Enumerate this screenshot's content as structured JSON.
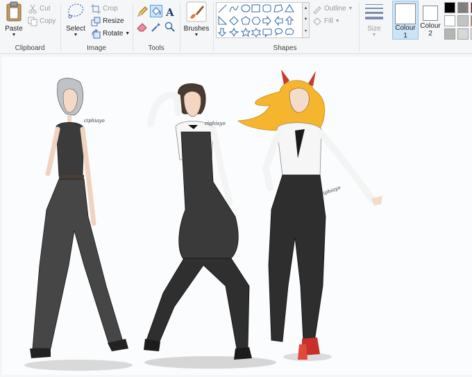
{
  "clipboard": {
    "paste_label": "Paste",
    "cut_label": "Cut",
    "copy_label": "Copy",
    "group_label": "Clipboard"
  },
  "image": {
    "select_label": "Select",
    "crop_label": "Crop",
    "resize_label": "Resize",
    "rotate_label": "Rotate",
    "group_label": "Image"
  },
  "tools": {
    "group_label": "Tools",
    "selected_tool": "fill-icon"
  },
  "brushes": {
    "label": "Brushes"
  },
  "shapes": {
    "outline_label": "Outline",
    "fill_label": "Fill",
    "group_label": "Shapes"
  },
  "size": {
    "label": "Size"
  },
  "colours": {
    "colour1_label": "Colour",
    "colour1_num": "1",
    "colour2_label": "Colour",
    "colour2_num": "2",
    "colour1_value": "#ffffff",
    "colour2_value": "#ffffff",
    "palette": [
      "#000000",
      "#7f7f7f",
      "#880015",
      "#ffffff",
      "#c3c3c3",
      "#b97a57",
      "#b0b8b0",
      "#d8d8d8",
      "#e8e8e8"
    ]
  },
  "canvas": {
    "signature": "ciphiayo"
  }
}
